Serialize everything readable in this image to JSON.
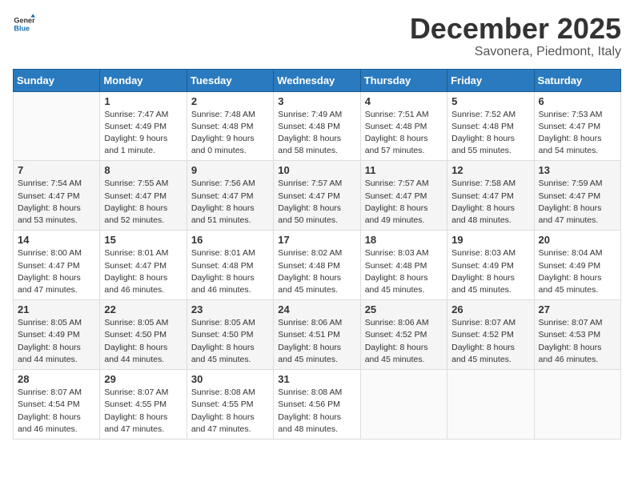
{
  "logo": {
    "general": "General",
    "blue": "Blue"
  },
  "title": {
    "month": "December 2025",
    "location": "Savonera, Piedmont, Italy"
  },
  "days_of_week": [
    "Sunday",
    "Monday",
    "Tuesday",
    "Wednesday",
    "Thursday",
    "Friday",
    "Saturday"
  ],
  "weeks": [
    [
      {
        "day": "",
        "detail": ""
      },
      {
        "day": "1",
        "detail": "Sunrise: 7:47 AM\nSunset: 4:49 PM\nDaylight: 9 hours\nand 1 minute."
      },
      {
        "day": "2",
        "detail": "Sunrise: 7:48 AM\nSunset: 4:48 PM\nDaylight: 9 hours\nand 0 minutes."
      },
      {
        "day": "3",
        "detail": "Sunrise: 7:49 AM\nSunset: 4:48 PM\nDaylight: 8 hours\nand 58 minutes."
      },
      {
        "day": "4",
        "detail": "Sunrise: 7:51 AM\nSunset: 4:48 PM\nDaylight: 8 hours\nand 57 minutes."
      },
      {
        "day": "5",
        "detail": "Sunrise: 7:52 AM\nSunset: 4:48 PM\nDaylight: 8 hours\nand 55 minutes."
      },
      {
        "day": "6",
        "detail": "Sunrise: 7:53 AM\nSunset: 4:47 PM\nDaylight: 8 hours\nand 54 minutes."
      }
    ],
    [
      {
        "day": "7",
        "detail": "Sunrise: 7:54 AM\nSunset: 4:47 PM\nDaylight: 8 hours\nand 53 minutes."
      },
      {
        "day": "8",
        "detail": "Sunrise: 7:55 AM\nSunset: 4:47 PM\nDaylight: 8 hours\nand 52 minutes."
      },
      {
        "day": "9",
        "detail": "Sunrise: 7:56 AM\nSunset: 4:47 PM\nDaylight: 8 hours\nand 51 minutes."
      },
      {
        "day": "10",
        "detail": "Sunrise: 7:57 AM\nSunset: 4:47 PM\nDaylight: 8 hours\nand 50 minutes."
      },
      {
        "day": "11",
        "detail": "Sunrise: 7:57 AM\nSunset: 4:47 PM\nDaylight: 8 hours\nand 49 minutes."
      },
      {
        "day": "12",
        "detail": "Sunrise: 7:58 AM\nSunset: 4:47 PM\nDaylight: 8 hours\nand 48 minutes."
      },
      {
        "day": "13",
        "detail": "Sunrise: 7:59 AM\nSunset: 4:47 PM\nDaylight: 8 hours\nand 47 minutes."
      }
    ],
    [
      {
        "day": "14",
        "detail": "Sunrise: 8:00 AM\nSunset: 4:47 PM\nDaylight: 8 hours\nand 47 minutes."
      },
      {
        "day": "15",
        "detail": "Sunrise: 8:01 AM\nSunset: 4:47 PM\nDaylight: 8 hours\nand 46 minutes."
      },
      {
        "day": "16",
        "detail": "Sunrise: 8:01 AM\nSunset: 4:48 PM\nDaylight: 8 hours\nand 46 minutes."
      },
      {
        "day": "17",
        "detail": "Sunrise: 8:02 AM\nSunset: 4:48 PM\nDaylight: 8 hours\nand 45 minutes."
      },
      {
        "day": "18",
        "detail": "Sunrise: 8:03 AM\nSunset: 4:48 PM\nDaylight: 8 hours\nand 45 minutes."
      },
      {
        "day": "19",
        "detail": "Sunrise: 8:03 AM\nSunset: 4:49 PM\nDaylight: 8 hours\nand 45 minutes."
      },
      {
        "day": "20",
        "detail": "Sunrise: 8:04 AM\nSunset: 4:49 PM\nDaylight: 8 hours\nand 45 minutes."
      }
    ],
    [
      {
        "day": "21",
        "detail": "Sunrise: 8:05 AM\nSunset: 4:49 PM\nDaylight: 8 hours\nand 44 minutes."
      },
      {
        "day": "22",
        "detail": "Sunrise: 8:05 AM\nSunset: 4:50 PM\nDaylight: 8 hours\nand 44 minutes."
      },
      {
        "day": "23",
        "detail": "Sunrise: 8:05 AM\nSunset: 4:50 PM\nDaylight: 8 hours\nand 45 minutes."
      },
      {
        "day": "24",
        "detail": "Sunrise: 8:06 AM\nSunset: 4:51 PM\nDaylight: 8 hours\nand 45 minutes."
      },
      {
        "day": "25",
        "detail": "Sunrise: 8:06 AM\nSunset: 4:52 PM\nDaylight: 8 hours\nand 45 minutes."
      },
      {
        "day": "26",
        "detail": "Sunrise: 8:07 AM\nSunset: 4:52 PM\nDaylight: 8 hours\nand 45 minutes."
      },
      {
        "day": "27",
        "detail": "Sunrise: 8:07 AM\nSunset: 4:53 PM\nDaylight: 8 hours\nand 46 minutes."
      }
    ],
    [
      {
        "day": "28",
        "detail": "Sunrise: 8:07 AM\nSunset: 4:54 PM\nDaylight: 8 hours\nand 46 minutes."
      },
      {
        "day": "29",
        "detail": "Sunrise: 8:07 AM\nSunset: 4:55 PM\nDaylight: 8 hours\nand 47 minutes."
      },
      {
        "day": "30",
        "detail": "Sunrise: 8:08 AM\nSunset: 4:55 PM\nDaylight: 8 hours\nand 47 minutes."
      },
      {
        "day": "31",
        "detail": "Sunrise: 8:08 AM\nSunset: 4:56 PM\nDaylight: 8 hours\nand 48 minutes."
      },
      {
        "day": "",
        "detail": ""
      },
      {
        "day": "",
        "detail": ""
      },
      {
        "day": "",
        "detail": ""
      }
    ]
  ]
}
